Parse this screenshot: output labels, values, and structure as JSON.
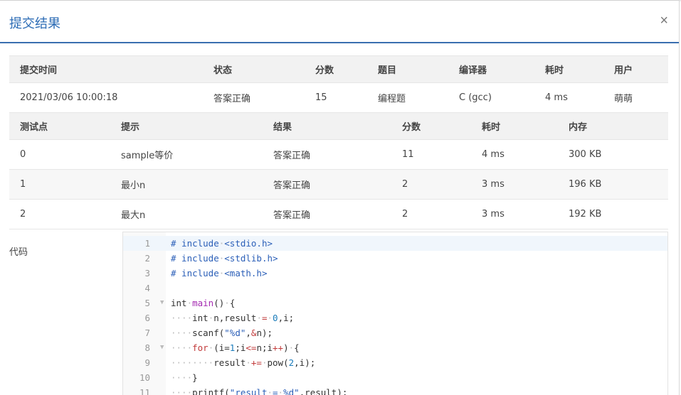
{
  "modal": {
    "title": "提交结果",
    "close_label": "×"
  },
  "summary": {
    "headers": [
      "提交时间",
      "状态",
      "分数",
      "题目",
      "编译器",
      "耗时",
      "用户"
    ],
    "row": {
      "time": "2021/03/06 10:00:18",
      "status": "答案正确",
      "score": "15",
      "problem": "编程题",
      "compiler": "C (gcc)",
      "elapsed": "4 ms",
      "user": "萌萌"
    }
  },
  "cases": {
    "headers": [
      "测试点",
      "提示",
      "结果",
      "分数",
      "耗时",
      "内存"
    ],
    "rows": [
      {
        "id": "0",
        "hint": "sample等价",
        "result": "答案正确",
        "score": "11",
        "time": "4 ms",
        "memory": "300 KB"
      },
      {
        "id": "1",
        "hint": "最小n",
        "result": "答案正确",
        "score": "2",
        "time": "3 ms",
        "memory": "196 KB"
      },
      {
        "id": "2",
        "hint": "最大n",
        "result": "答案正确",
        "score": "2",
        "time": "3 ms",
        "memory": "192 KB"
      }
    ]
  },
  "code": {
    "label": "代码",
    "line_numbers": [
      "1",
      "2",
      "3",
      "4",
      "5",
      "6",
      "7",
      "8",
      "9",
      "10",
      "11"
    ]
  },
  "colors": {
    "accent": "#2d6cb5",
    "ok": "#e33b3b",
    "header_bg": "#f2f2f2"
  }
}
